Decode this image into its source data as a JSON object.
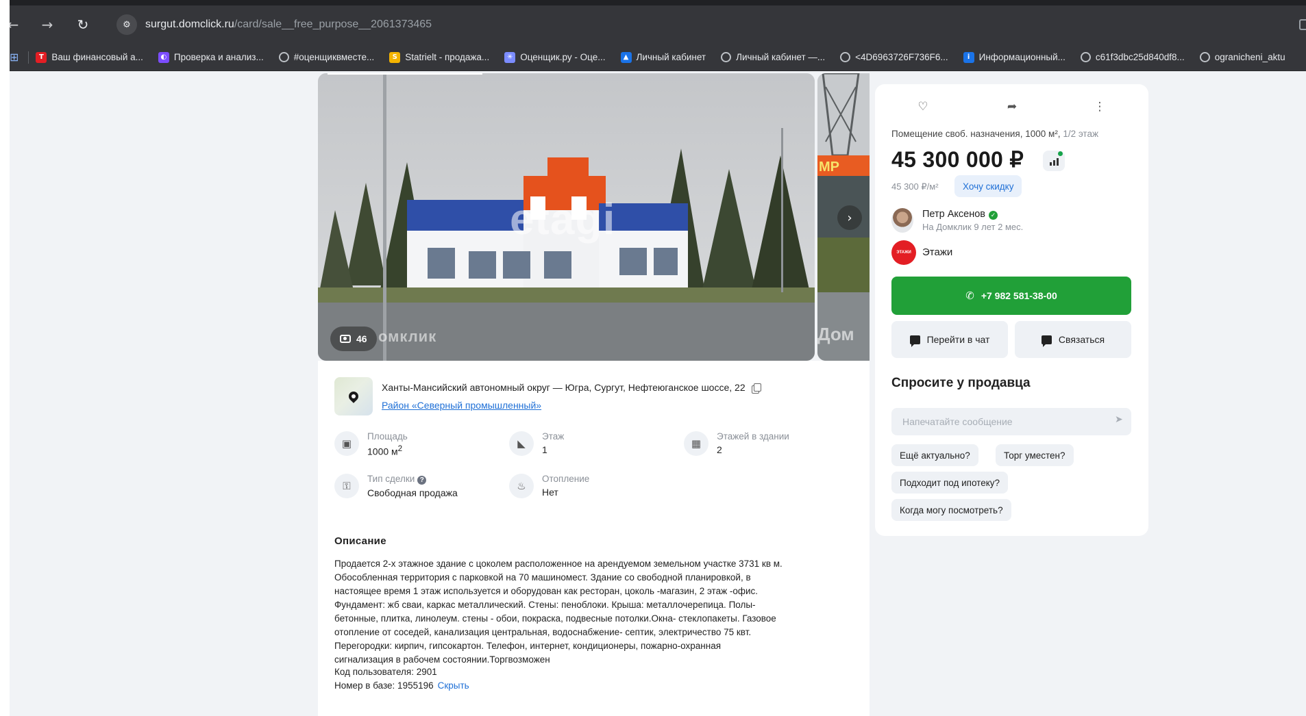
{
  "browser": {
    "url_host": "surgut.domclick.ru",
    "url_path": "/card/sale__free_purpose__2061373465",
    "bookmarks": [
      {
        "label": "Ваш финансовый а...",
        "icon": "bank-icon",
        "color": "#e31e24"
      },
      {
        "label": "Проверка и анализ...",
        "icon": "check-icon",
        "color": "#7c4dff"
      },
      {
        "label": "#оценщиквместе...",
        "icon": "globe-icon",
        "color": ""
      },
      {
        "label": "Statrielt - продажа...",
        "icon": "statrielt-icon",
        "color": "#f4b400"
      },
      {
        "label": "Оценщик.ру - Оце...",
        "icon": "snowflake-icon",
        "color": "#7b8cff"
      },
      {
        "label": "Личный кабинет",
        "icon": "map-icon",
        "color": "#1a73e8"
      },
      {
        "label": "Личный кабинет —...",
        "icon": "globe-icon",
        "color": ""
      },
      {
        "label": "<4D6963726F736F6...",
        "icon": "globe-icon",
        "color": ""
      },
      {
        "label": "Информационный...",
        "icon": "info-icon",
        "color": "#1a73e8"
      },
      {
        "label": "c61f3dbc25d840df8...",
        "icon": "globe-icon",
        "color": ""
      },
      {
        "label": "ogranicheni_aktu",
        "icon": "globe-icon",
        "color": ""
      }
    ]
  },
  "gallery": {
    "photo_count": "46",
    "watermark_main": "омклик",
    "watermark_agency": "etagi",
    "side_watermark": "Дом",
    "side_sign": "МР"
  },
  "location": {
    "address": "Ханты-Мансийский автономный округ — Югра, Сургут, Нефтеюганское шоссе, 22",
    "district": "Район «Северный промышленный»"
  },
  "params": [
    {
      "label": "Площадь",
      "value": "1000 м",
      "sup": "2",
      "icon": "area-icon"
    },
    {
      "label": "Этаж",
      "value": "1",
      "icon": "floor-icon"
    },
    {
      "label": "Этажей в здании",
      "value": "2",
      "icon": "building-icon"
    },
    {
      "label": "Тип сделки",
      "value": "Свободная продажа",
      "icon": "key-icon"
    },
    {
      "label": "Отопление",
      "value": "Нет",
      "icon": "heating-icon"
    }
  ],
  "description": {
    "title": "Описание",
    "text": "Продается 2-х этажное здание с цоколем расположенное на арендуемом земельном участке 3731 кв м.\nОбособленная территория с парковкой на 70 машиномест. Здание со свободной планировкой, в\nнастоящее время 1 этаж используется и оборудован как ресторан, цоколь -магазин, 2 этаж -офис.\nФундамент: жб сваи, каркас металлический. Стены: пеноблоки. Крыша: металлочерепица. Полы-\nбетонные, плитка, линолеум. стены - обои, покраска, подвесные потолки.Окна- стеклопакеты. Газовое\nотопление от соседей, канализация центральная, водоснабжение- септик, электричество 75 квт.\nПерегородки: кирпич, гипсокартон. Телефон, интернет, кондиционеры, пожарно-охранная\nсигнализация в рабочем состоянии.Торгвозможен",
    "user_code": "Код пользователя: 2901",
    "db_number": "Номер в базе: 1955196",
    "hide_label": "Скрыть"
  },
  "card": {
    "subtitle_main": "Помещение своб. назначения, 1000 м², ",
    "subtitle_floor": "1/2 этаж",
    "price": "45 300 000 ₽",
    "price_per_m2": "45 300 ₽/м²",
    "discount_label": "Хочу скидку",
    "agent_name": "Петр Аксенов",
    "agent_experience": "На Домклик 9 лет 2 мес.",
    "agency_logo_text": "ЭТАЖИ",
    "agency_name": "Этажи",
    "phone": "+7 982 581-38-00",
    "chat_label": "Перейти в чат",
    "contact_label": "Связаться",
    "ask_title": "Спросите у продавца",
    "ask_placeholder": "Напечатайте сообщение",
    "chips": [
      "Ещё актуально?",
      "Торг уместен?",
      "Подходит под ипотеку?",
      "Когда могу посмотреть?"
    ],
    "accent_green": "#21a038",
    "accent_blue": "#1e6fd6"
  }
}
